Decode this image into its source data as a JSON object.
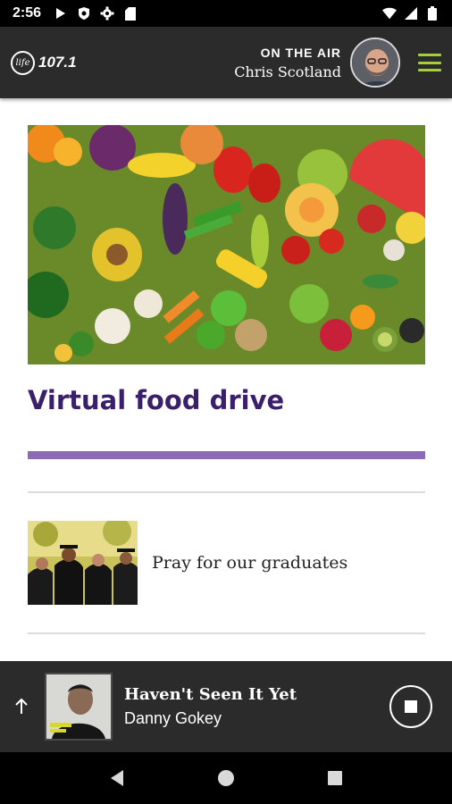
{
  "status_bar": {
    "time": "2:56",
    "icons": [
      "play-icon",
      "shield-icon",
      "gear-icon",
      "sd-card-icon",
      "wifi-icon",
      "signal-icon",
      "battery-icon"
    ]
  },
  "header": {
    "logo_mark": "life",
    "logo_frequency": "107.1",
    "on_air_label": "ON THE AIR",
    "host_name": "Chris Scotland",
    "accent_color": "#a6ce39"
  },
  "article": {
    "title": "Virtual food drive",
    "title_color": "#3a1f6a",
    "rule_color": "#8e6bb5"
  },
  "list": {
    "items": [
      {
        "title": "Pray for our graduates"
      }
    ]
  },
  "player": {
    "track_title": "Haven't Seen It Yet",
    "artist": "Danny Gokey",
    "state": "playing"
  },
  "nav": {
    "buttons": [
      "back-icon",
      "home-icon",
      "recents-icon"
    ]
  }
}
